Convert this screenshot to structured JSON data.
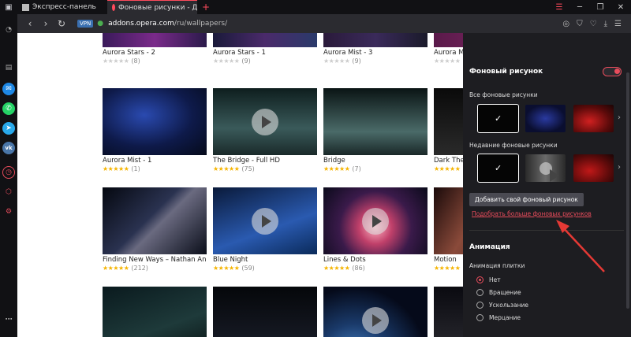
{
  "tabs": [
    {
      "label": "Экспресс-панель",
      "active": false
    },
    {
      "label": "Фоновые рисунки - Допо",
      "active": true
    }
  ],
  "window_controls": [
    "menu-icon",
    "minimize-icon",
    "maximize-icon",
    "close-icon"
  ],
  "address": {
    "vpn": "VPN",
    "url_host": "addons.opera.com",
    "url_path": "/ru/wallpapers/"
  },
  "cards": [
    {
      "title": "Aurora Stars - 2",
      "count": "(8)",
      "stars": 0
    },
    {
      "title": "Aurora Stars - 1",
      "count": "(9)",
      "stars": 0
    },
    {
      "title": "Aurora Mist - 3",
      "count": "(9)",
      "stars": 0
    },
    {
      "title": "Aurora M",
      "count": "",
      "stars": 0
    },
    {
      "title": "Aurora Mist - 1",
      "count": "(1)",
      "stars": 4.5
    },
    {
      "title": "The Bridge - Full HD",
      "count": "(75)",
      "stars": 4.5
    },
    {
      "title": "Bridge",
      "count": "(7)",
      "stars": 4.5
    },
    {
      "title": "Dark The",
      "count": "",
      "stars": 4.5
    },
    {
      "title": "Finding New Ways – Nathan Ande...",
      "count": "(212)",
      "stars": 5
    },
    {
      "title": "Blue Night",
      "count": "(59)",
      "stars": 4.5
    },
    {
      "title": "Lines & Dots",
      "count": "(86)",
      "stars": 4.5
    },
    {
      "title": "Motion",
      "count": "",
      "stars": 5
    }
  ],
  "panel": {
    "wallpaper_title": "Фоновый рисунок",
    "wallpaper_enabled": true,
    "all_label": "Все фоновые рисунки",
    "recent_label": "Недавние фоновые рисунки",
    "add_button": "Добавить свой фоновый рисунок",
    "more_link": "Подобрать больше фоновых рисунков",
    "animation_title": "Анимация",
    "tile_anim_label": "Анимация плитки",
    "radio_options": [
      "Нет",
      "Вращение",
      "Ускользание",
      "Мерцание"
    ],
    "radio_selected": "Нет"
  },
  "colors": {
    "accent": "#e94c5c",
    "arrow": "#e53935",
    "star": "#f5b400"
  }
}
